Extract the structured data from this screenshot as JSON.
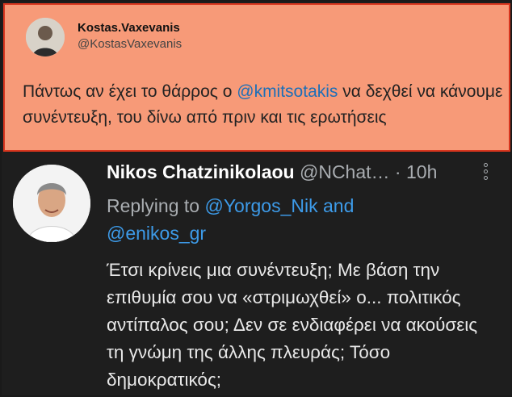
{
  "top_tweet": {
    "name": "Kostas.Vaxevanis",
    "handle": "@KostasVaxevanis",
    "text_before": "Πάντως αν έχει το θάρρος ο ",
    "mention": "@kmitsotakis",
    "text_after": " να δεχθεί να κάνουμε συνέντευξη, του δίνω από πριν και τις ερωτήσεις",
    "highlight_color": "#f79a78",
    "border_color": "#d9361e"
  },
  "reply": {
    "name": "Nikos Chatzinikolaou",
    "handle": "@NChat…",
    "separator": " · ",
    "time": "10h",
    "replying_prefix": "Replying to ",
    "reply_to_1": "@Yorgos_Nik",
    "reply_to_and": " and",
    "reply_to_2": "@enikos_gr",
    "body": "Έτσι κρίνεις μια συνέντευξη; Με βάση την επιθυμία σου να «στριμωχθεί» ο... πολιτικός αντίπαλος σου; Δεν σε ενδιαφέρει να ακούσεις τη γνώμη της άλλης πλευράς; Τόσο δημοκρατικός;",
    "more_icon": "more-vertical-icon",
    "link_color": "#3d9be9",
    "background": "#1e1e1e"
  }
}
